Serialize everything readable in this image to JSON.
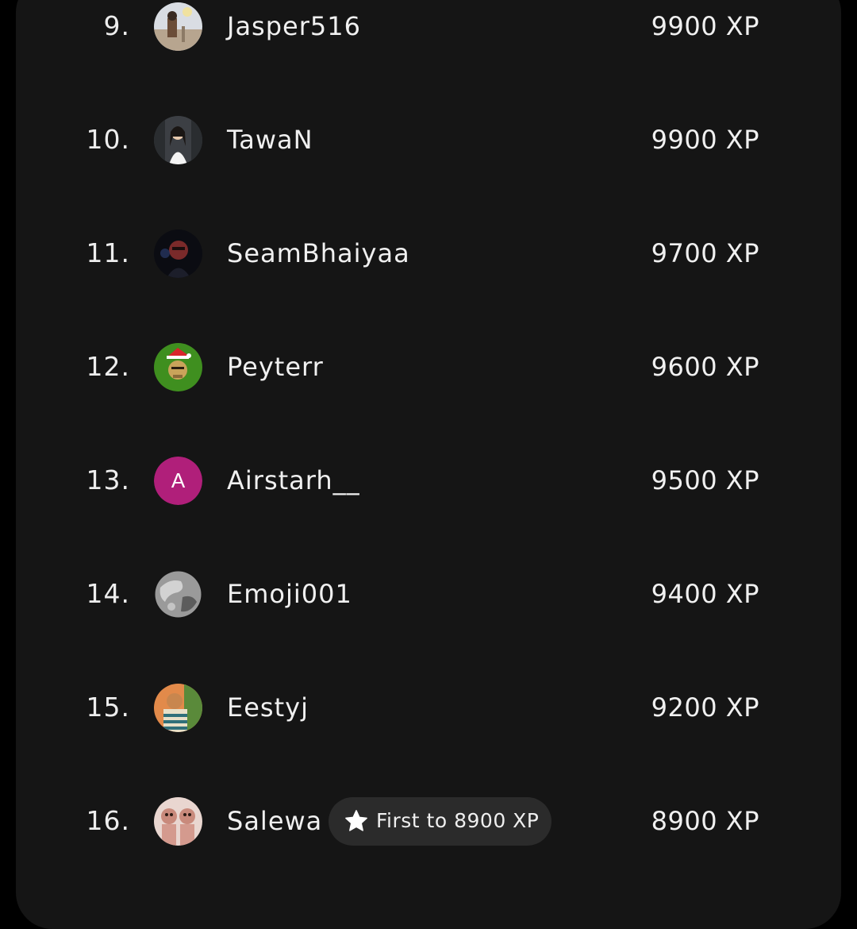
{
  "leaderboard": {
    "rows": [
      {
        "rank": "9.",
        "name": "Jasper516",
        "xp": "9900 XP",
        "avatar": "photo-avatar"
      },
      {
        "rank": "10.",
        "name": "TawaN",
        "xp": "9900 XP",
        "avatar": "photo-avatar"
      },
      {
        "rank": "11.",
        "name": "SeamBhaiyaa",
        "xp": "9700 XP",
        "avatar": "photo-avatar"
      },
      {
        "rank": "12.",
        "name": "Peyterr",
        "xp": "9600 XP",
        "avatar": "ape-avatar"
      },
      {
        "rank": "13.",
        "name": "Airstarh__",
        "xp": "9500 XP",
        "avatar": "letter-avatar",
        "avatar_letter": "A",
        "avatar_color": "#b01f7a"
      },
      {
        "rank": "14.",
        "name": "Emoji001",
        "xp": "9400 XP",
        "avatar": "globe-avatar"
      },
      {
        "rank": "15.",
        "name": "Eestyj",
        "xp": "9200 XP",
        "avatar": "cartoon-avatar"
      },
      {
        "rank": "16.",
        "name": "Salewa",
        "xp": "8900 XP",
        "avatar": "photo-avatar",
        "achievement": {
          "icon": "star-icon",
          "label": "First to 8900 XP"
        }
      }
    ]
  },
  "colors": {
    "background": "#000000",
    "card": "#151515",
    "chip": "#2b2b2b",
    "text": "#f0f0f0"
  }
}
